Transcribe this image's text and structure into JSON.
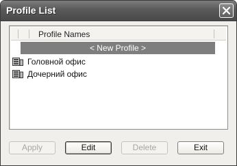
{
  "window": {
    "title": "Profile List"
  },
  "list": {
    "column_header": "Profile Names",
    "new_profile": "< New Profile >",
    "items": [
      {
        "label": "Головной офис",
        "icon": "office-server-icon"
      },
      {
        "label": "Дочерний офис",
        "icon": "office-server-icon"
      }
    ]
  },
  "buttons": {
    "apply": "Apply",
    "edit": "Edit",
    "delete": "Delete",
    "exit": "Exit"
  },
  "colors": {
    "titlebar": "#595959",
    "selection": "#7e7e7e",
    "dialog_bg": "#f0efec"
  }
}
